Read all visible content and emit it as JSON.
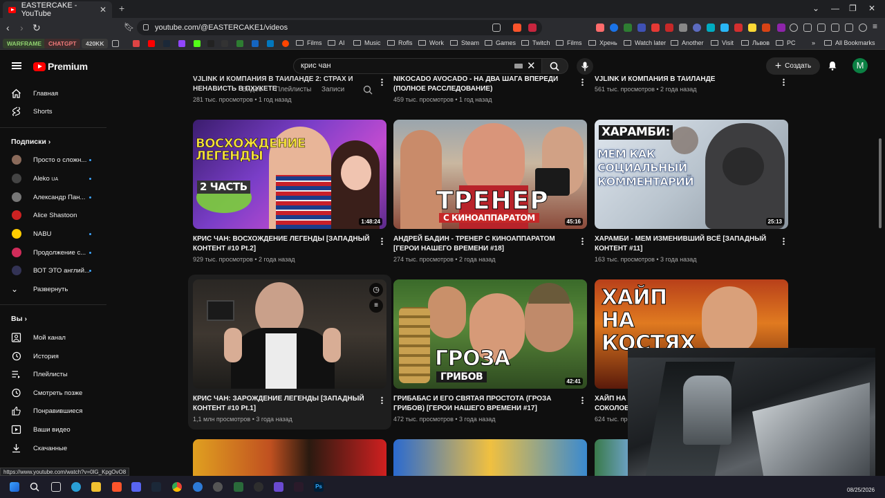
{
  "browser": {
    "tab_title": "EASTERCAKE - YouTube",
    "new_tab": "+",
    "url": "youtube.com/@EASTERCAKE1/videos",
    "status_url": "https://www.youtube.com/watch?v=0lG_KpgOvO8",
    "bookmark_pills": [
      "WARFRAME",
      "CHATGPT",
      "420KK"
    ],
    "bookmarks": [
      "Films",
      "AI",
      "Music",
      "Rofls",
      "Work",
      "Steam",
      "Games",
      "Twitch",
      "Films",
      "Хрень",
      "Watch later",
      "Another",
      "Visit",
      "Львов",
      "PC"
    ],
    "all_bookmarks": "All Bookmarks",
    "more": "»"
  },
  "header": {
    "logo": "Premium",
    "search_value": "крис чан",
    "create_label": "Создать",
    "avatar_letter": "M"
  },
  "sidebar": {
    "main": [
      {
        "label": "Главная",
        "icon": "home-icon"
      },
      {
        "label": "Shorts",
        "icon": "shorts-icon"
      }
    ],
    "subs_title": "Подписки",
    "subs": [
      {
        "label": "Просто о сложн...",
        "color": "#8a6a5a"
      },
      {
        "label": "Aleko",
        "suffix": "UA",
        "color": "#444"
      },
      {
        "label": "Александр Пан...",
        "color": "#777"
      },
      {
        "label": "Alice Shastoon",
        "color": "#c22"
      },
      {
        "label": "NABU",
        "color": "#ffcc00"
      },
      {
        "label": "Продолжение с...",
        "color": "#d02c5a"
      },
      {
        "label": "ВОТ ЭТО англий...",
        "color": "#335"
      }
    ],
    "expand": "Развернуть",
    "you_title": "Вы",
    "you": [
      {
        "label": "Мой канал",
        "icon": "channel-icon"
      },
      {
        "label": "История",
        "icon": "history-icon"
      },
      {
        "label": "Плейлисты",
        "icon": "playlists-icon"
      },
      {
        "label": "Смотреть позже",
        "icon": "watch-later-icon"
      },
      {
        "label": "Понравившиеся",
        "icon": "like-icon"
      },
      {
        "label": "Ваши видео",
        "icon": "your-videos-icon"
      },
      {
        "label": "Скачанные",
        "icon": "downloads-icon"
      }
    ]
  },
  "channel_tabs_ghost": {
    "videos": "Видео",
    "playlists": "Плейлисты",
    "posts": "Записи"
  },
  "top_row": [
    {
      "title": "VJLINK И КОМПАНИЯ В ТАИЛАНДЕ 2: СТРАХ И НЕНАВИСТЬ В ПХУКЕТЕ",
      "meta": "281 тыс. просмотров • 1 год назад"
    },
    {
      "title": "NIKOCADO AVOCADO - НА ДВА ШАГА ВПЕРЕДИ (ПОЛНОЕ РАССЛЕДОВАНИЕ)",
      "meta": "459 тыс. просмотров • 1 год назад"
    },
    {
      "title": "VJLINK И КОМПАНИЯ В ТАИЛАНДЕ",
      "meta": "561 тыс. просмотров • 2 года назад"
    }
  ],
  "row1": [
    {
      "title": "КРИС ЧАН: ВОСХОЖДЕНИЕ ЛЕГЕНДЫ [ЗАПАДНЫЙ КОНТЕНТ #10 Pt.2]",
      "meta": "929 тыс. просмотров • 2 года назад",
      "duration": "1:48:24",
      "thumb_text": "ВОСХОЖДЕНИЕ ЛЕГЕНДЫ",
      "thumb_sub": "2 ЧАСТЬ"
    },
    {
      "title": "АНДРЕЙ БАДИН - ТРЕНЕР С КИНОАППАРАТОМ [ГЕРОИ НАШЕГО ВРЕМЕНИ #18]",
      "meta": "274 тыс. просмотров • 2 года назад",
      "duration": "45:16",
      "thumb_text": "ТРЕНЕР",
      "thumb_sub": "С КИНОАППАРАТОМ"
    },
    {
      "title": "ХАРАМБИ - МЕМ ИЗМЕНИВШИЙ ВСЁ [ЗАПАДНЫЙ КОНТЕНТ #11]",
      "meta": "163 тыс. просмотров • 3 года назад",
      "duration": "25:13",
      "thumb_text": "ХАРАМБИ:",
      "thumb_sub": "МЕМ КАК СОЦИАЛЬНЫЙ КОММЕНТАРИЙ"
    }
  ],
  "row2": [
    {
      "title": "КРИС ЧАН: ЗАРОЖДЕНИЕ ЛЕГЕНДЫ [ЗАПАДНЫЙ КОНТЕНТ #10 Pt.1]",
      "meta": "1,1 млн просмотров • 3 года назад",
      "duration": ""
    },
    {
      "title": "ГРИБАБАС И ЕГО СВЯТАЯ ПРОСТОТА (ГРОЗА ГРИБОВ) [ГЕРОИ НАШЕГО ВРЕМЕНИ #17]",
      "meta": "472 тыс. просмотров • 3 года назад",
      "duration": "42:41",
      "thumb_text": "ГРОЗА",
      "thumb_sub": "ГРИБОВ"
    },
    {
      "title": "ХАЙП НА КОСТЯХ",
      "title_tail": "СОКОЛОВ",
      "meta": "624 тыс. просмотров",
      "duration": "",
      "thumb_text": "ХАЙП НА КОСТЯХ"
    }
  ],
  "taskbar": {
    "date": "08/25/2026"
  },
  "colors": {
    "accent": "#ff0000",
    "link_blue": "#3ea6ff",
    "bg": "#0f0f0f"
  }
}
